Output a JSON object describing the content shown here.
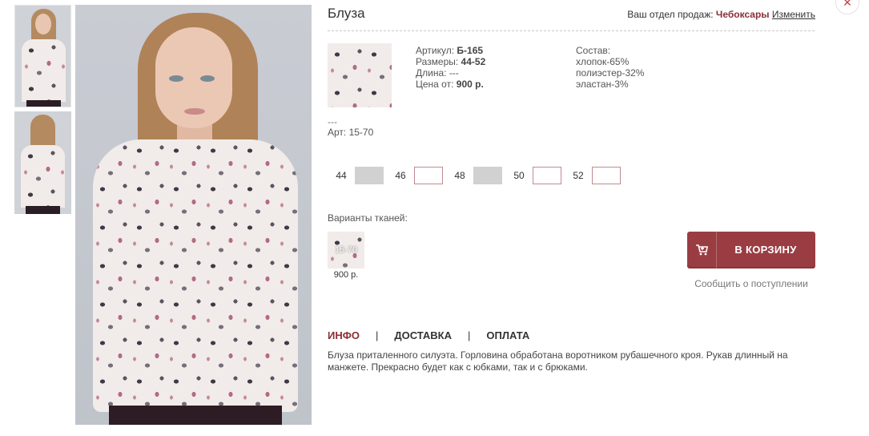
{
  "product": {
    "title": "Блуза",
    "article_label": "Артикул: ",
    "article": "Б-165",
    "sizes_label": "Размеры: ",
    "sizes_range": "44-52",
    "length_label": "Длина: ",
    "length": "---",
    "price_label": "Цена от: ",
    "price": "900 р.",
    "composition_title": "Состав:",
    "composition": [
      "хлопок-65%",
      "полиэстер-32%",
      "эластан-3%"
    ],
    "dash": "---",
    "art_line": "Арт: 15-70"
  },
  "department": {
    "label": "Ваш отдел продаж: ",
    "city": "Чебоксары",
    "change": "Изменить"
  },
  "close_symbol": "✕",
  "sizes": [
    {
      "label": "44",
      "available": false
    },
    {
      "label": "46",
      "available": true
    },
    {
      "label": "48",
      "available": false
    },
    {
      "label": "50",
      "available": true
    },
    {
      "label": "52",
      "available": true
    }
  ],
  "variants": {
    "label": "Варианты тканей:",
    "items": [
      {
        "code": "15-70",
        "price": "900 р."
      }
    ]
  },
  "cart": {
    "label": "В КОРЗИНУ",
    "icon": "cart-icon"
  },
  "notify": "Сообщить о поступлении",
  "tabs": [
    {
      "label": "ИНФО",
      "active": true
    },
    {
      "label": "ДОСТАВКА",
      "active": false
    },
    {
      "label": "ОПЛАТА",
      "active": false
    }
  ],
  "description": "Блуза приталенного силуэта. Горловина обработана воротником рубашечного кроя. Рукав длинный на манжете. Прекрасно будет как с юбками, так и с брюками.",
  "colors": {
    "accent": "#9a3d43",
    "accent_text": "#8b2e35",
    "size_unavailable": "#d1d1d1"
  }
}
